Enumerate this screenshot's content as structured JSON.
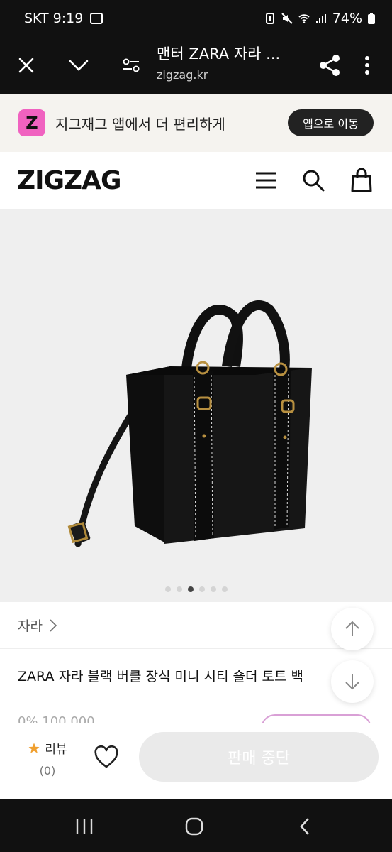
{
  "status": {
    "carrier": "SKT",
    "time": "9:19",
    "battery": "74%"
  },
  "browser": {
    "title": "맨터 ZARA 자라 ...",
    "url": "zigzag.kr"
  },
  "banner": {
    "logo": "Z",
    "text": "지그재그 앱에서 더 편리하게",
    "button": "앱으로 이동"
  },
  "header": {
    "brand": "ZIGZAG"
  },
  "gallery": {
    "total": 6,
    "active_index": 2
  },
  "product": {
    "brand_link": "자라",
    "title": "ZARA 자라 블랙 버클 장식 미니 시티 숄더 토트 백",
    "price_peek": "0% 100,000"
  },
  "action_bar": {
    "review_label": "리뷰",
    "review_count": "(0)",
    "status_button": "판매 중단"
  },
  "colors": {
    "accent_pink": "#f062c0",
    "star": "#f0a030"
  }
}
